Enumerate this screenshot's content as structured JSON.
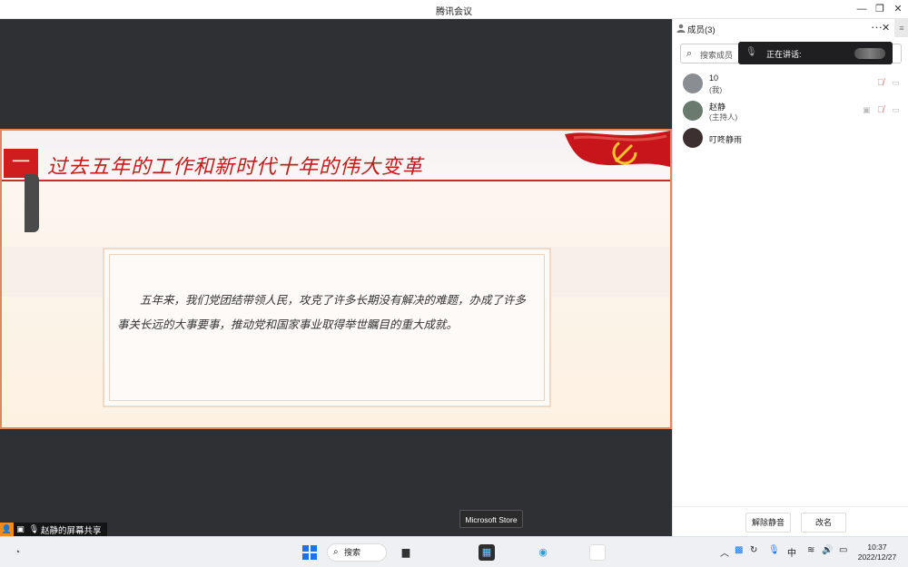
{
  "window": {
    "title": "腾讯会议"
  },
  "slide": {
    "number": "一",
    "title": "过去五年的工作和新时代十年的伟大变革",
    "body": "五年来，我们党团结带领人民，攻克了许多长期没有解决的难题，办成了许多事关长远的大事要事，推动党和国家事业取得举世瞩目的重大成就。"
  },
  "share_indicator": {
    "label": "赵静的屏幕共享"
  },
  "tooltip": {
    "label": "Microsoft Store"
  },
  "panel": {
    "header_label": "成员(3)",
    "search_placeholder": "搜索成员",
    "speaking_label": "正在讲话:",
    "members": [
      {
        "name": "10",
        "role": "(我)",
        "avatar_color": "#8a8d92"
      },
      {
        "name": "赵静",
        "role": "(主持人)",
        "avatar_color": "#6b7a6e"
      },
      {
        "name": "叮咚静雨",
        "role": "",
        "avatar_color": "#3c3030"
      }
    ],
    "unmute_all": "解除静音",
    "rename": "改名"
  },
  "taskbar": {
    "search_label": "搜索",
    "ime": "中",
    "time": "10:37",
    "date": "2022/12/27"
  },
  "colors": {
    "accent_red": "#cf1d1d",
    "stage": "#2e3033"
  }
}
